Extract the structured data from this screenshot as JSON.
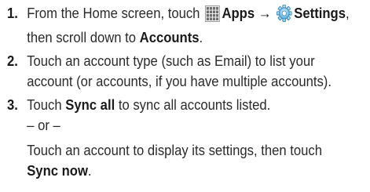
{
  "steps": [
    {
      "number": "1.",
      "text_a": "From the Home screen, touch",
      "apps_label": "Apps",
      "arrow": "→",
      "settings_label": "Settings",
      "comma": ",",
      "text_b": "then scroll down to",
      "accounts_label": "Accounts",
      "period": "."
    },
    {
      "number": "2.",
      "line1": "Touch an account type (such as Email) to list your",
      "line2": "account (or accounts, if you have multiple accounts)."
    },
    {
      "number": "3.",
      "text_a": "Touch",
      "sync_all_label": "Sync all",
      "text_b": "to sync all accounts listed.",
      "or_text": "– or –",
      "text_c": "Touch an account to display its settings, then touch",
      "sync_now_label": "Sync now",
      "period": "."
    }
  ],
  "icons": {
    "apps": "apps-grid-icon",
    "settings": "settings-gear-icon"
  }
}
